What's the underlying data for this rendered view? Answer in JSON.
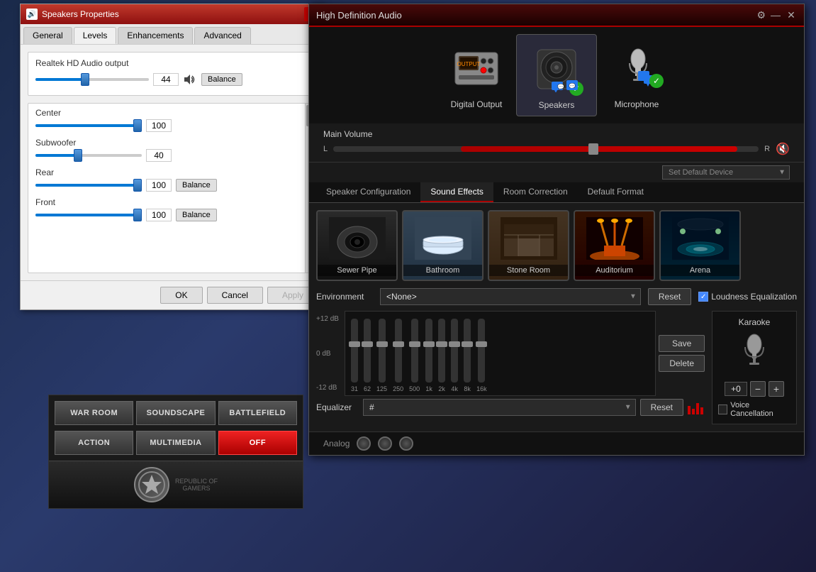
{
  "speakers_window": {
    "title": "Speakers Properties",
    "tabs": [
      "General",
      "Levels",
      "Enhancements",
      "Advanced"
    ],
    "active_tab": "Levels",
    "realtek_label": "Realtek HD Audio output",
    "realtek_volume": "44",
    "channels": [
      {
        "name": "Center",
        "value": "100",
        "has_balance": false
      },
      {
        "name": "Subwoofer",
        "value": "40",
        "has_balance": false
      },
      {
        "name": "Rear",
        "value": "100",
        "has_balance": true
      },
      {
        "name": "Front",
        "value": "100",
        "has_balance": true
      }
    ],
    "buttons": [
      "OK",
      "Cancel",
      "Apply"
    ]
  },
  "rog_panel": {
    "buttons_row1": [
      "WAR ROOM",
      "SOUNDSCAPE",
      "BATTLEFIELD"
    ],
    "buttons_row2": [
      "ACTION",
      "MULTIMEDIA",
      "OFF"
    ],
    "active_button": "OFF",
    "logo_text": "REPUBLIC OF\nGAMERS"
  },
  "hda_window": {
    "title": "High Definition Audio",
    "devices": [
      {
        "name": "Digital Output",
        "active": false,
        "has_chat": false,
        "has_check": false
      },
      {
        "name": "Speakers",
        "active": true,
        "has_chat": true,
        "has_check": true
      },
      {
        "name": "Microphone",
        "active": false,
        "has_chat": true,
        "has_check": true
      }
    ],
    "main_volume_label": "Main Volume",
    "main_volume_l": "L",
    "main_volume_r": "R",
    "set_default_label": "Set Default Device",
    "tabs": [
      "Speaker Configuration",
      "Sound Effects",
      "Room Correction",
      "Default Format"
    ],
    "active_tab": "Sound Effects",
    "environments": [
      {
        "name": "Sewer Pipe",
        "selected": false
      },
      {
        "name": "Bathroom",
        "selected": false
      },
      {
        "name": "Stone Room",
        "selected": false
      },
      {
        "name": "Auditorium",
        "selected": false
      },
      {
        "name": "Arena",
        "selected": false
      }
    ],
    "environment_label": "Environment",
    "environment_value": "<None>",
    "reset_label": "Reset",
    "loudness_label": "Loudness Equalization",
    "equalizer_label": "Equalizer",
    "equalizer_value": "#",
    "eq_labels_plus": "+12 dB",
    "eq_labels_zero": "0 dB",
    "eq_labels_minus": "-12 dB",
    "eq_freqs": [
      "31",
      "62",
      "125",
      "250",
      "500",
      "1k",
      "2k",
      "4k",
      "8k",
      "16k"
    ],
    "save_label": "Save",
    "delete_label": "Delete",
    "karaoke_label": "Karaoke",
    "karaoke_value": "+0",
    "voice_cancel_label": "Voice Cancellation",
    "analog_label": "Analog"
  }
}
